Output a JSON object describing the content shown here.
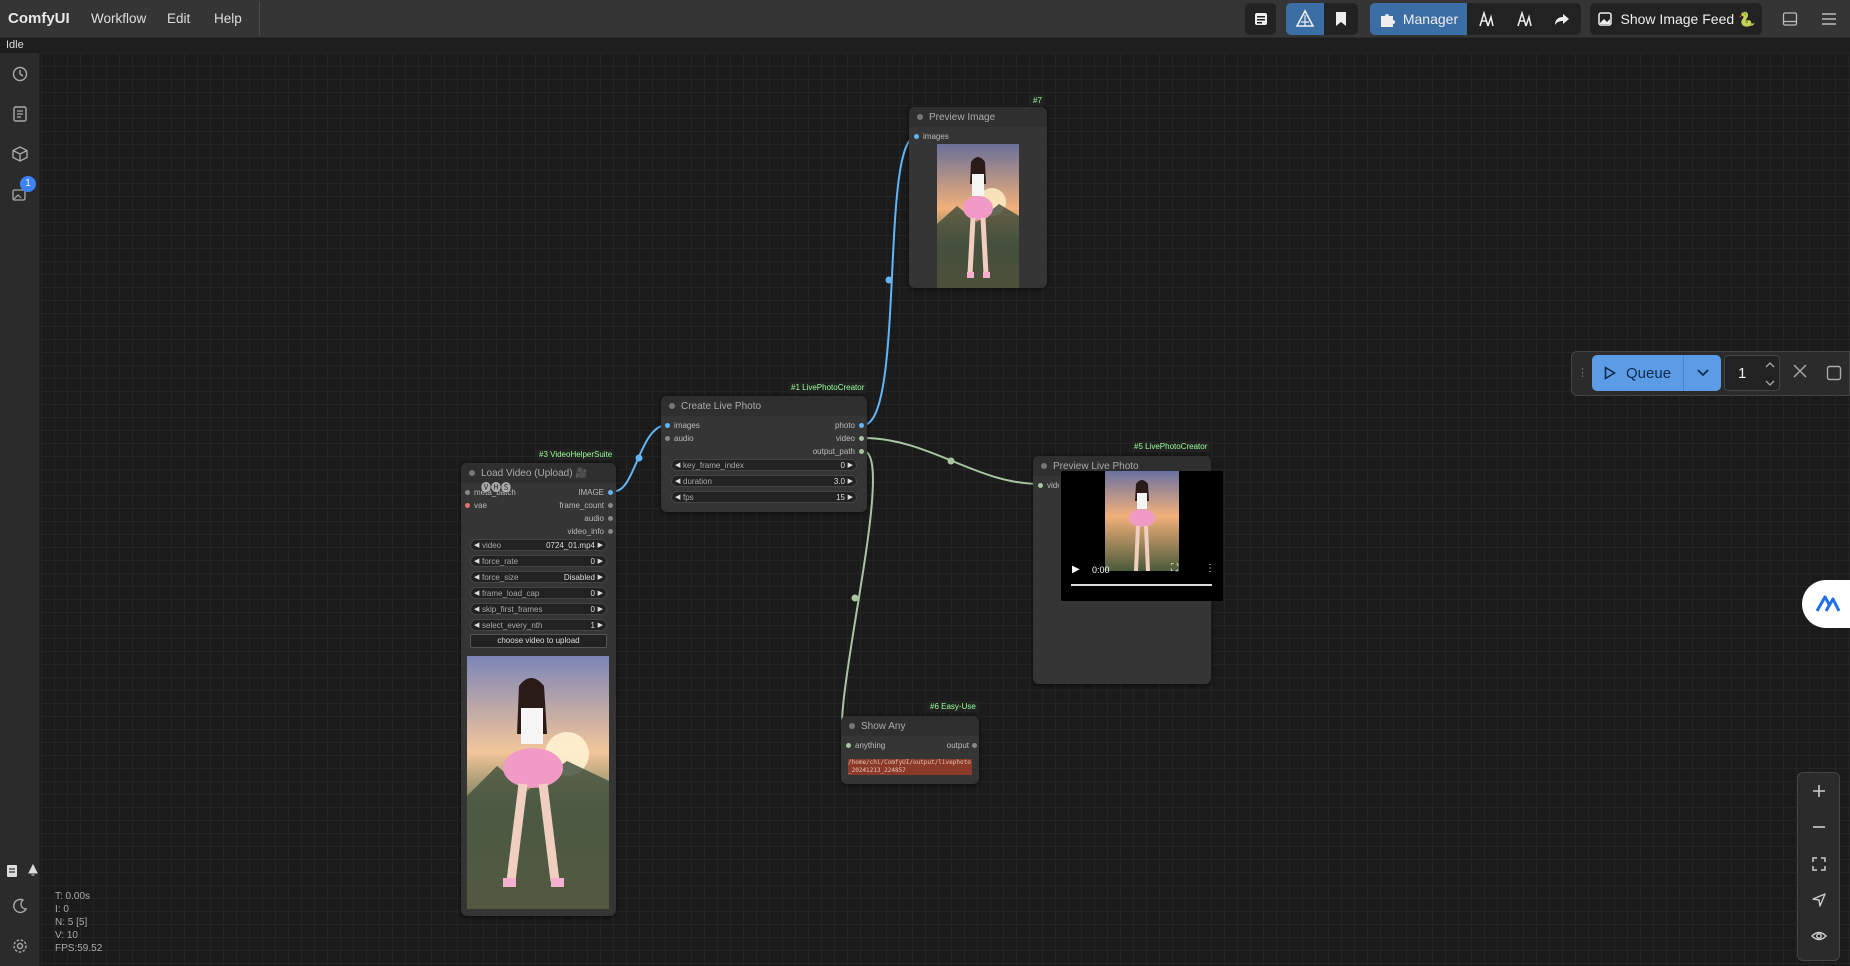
{
  "app": {
    "title": "ComfyUI",
    "status": "Idle"
  },
  "menu": [
    "Workflow",
    "Edit",
    "Help"
  ],
  "toolbar": {
    "manager_label": "Manager",
    "image_feed_label": "Show Image Feed 🐍"
  },
  "sidebar": {
    "queue_badge": "1"
  },
  "queue": {
    "label": "Queue",
    "count": "1"
  },
  "stats": {
    "t": "T: 0.00s",
    "i": "I: 0",
    "n": "N: 5 [5]",
    "v": "V: 10",
    "fps": "FPS:59.52"
  },
  "nodes": {
    "preview_image": {
      "badge": "#7",
      "title": "Preview Image",
      "input": "images"
    },
    "create_live_photo": {
      "badge": "#1 LivePhotoCreator",
      "title": "Create Live Photo",
      "inputs": [
        "images",
        "audio"
      ],
      "outputs": [
        "photo",
        "video",
        "output_path"
      ],
      "widgets": [
        {
          "label": "key_frame_index",
          "value": "0"
        },
        {
          "label": "duration",
          "value": "3.0"
        },
        {
          "label": "fps",
          "value": "15"
        }
      ]
    },
    "load_video": {
      "badge": "#3 VideoHelperSuite",
      "title": "Load Video (Upload) 🎥🅥🅗🅢",
      "inputs": [
        "meta_batch",
        "vae"
      ],
      "outputs": [
        "IMAGE",
        "frame_count",
        "audio",
        "video_info"
      ],
      "widgets": [
        {
          "label": "video",
          "value": "0724_01.mp4"
        },
        {
          "label": "force_rate",
          "value": "0"
        },
        {
          "label": "force_size",
          "value": "Disabled"
        },
        {
          "label": "frame_load_cap",
          "value": "0"
        },
        {
          "label": "skip_first_frames",
          "value": "0"
        },
        {
          "label": "select_every_nth",
          "value": "1"
        }
      ],
      "upload_button": "choose video to upload"
    },
    "preview_live_photo": {
      "badge": "#5 LivePhotoCreator",
      "title": "Preview Live Photo",
      "input": "video",
      "time": "0:00"
    },
    "show_any": {
      "badge": "#6 Easy-Use",
      "title": "Show Any",
      "input": "anything",
      "output": "output",
      "text": "/home/chi/ComfyUI/output/livephoto_20241213_224857"
    }
  },
  "colors": {
    "accent": "#4a90e2",
    "link_image": "#64b5f6",
    "link_video": "#a8c4a0"
  }
}
